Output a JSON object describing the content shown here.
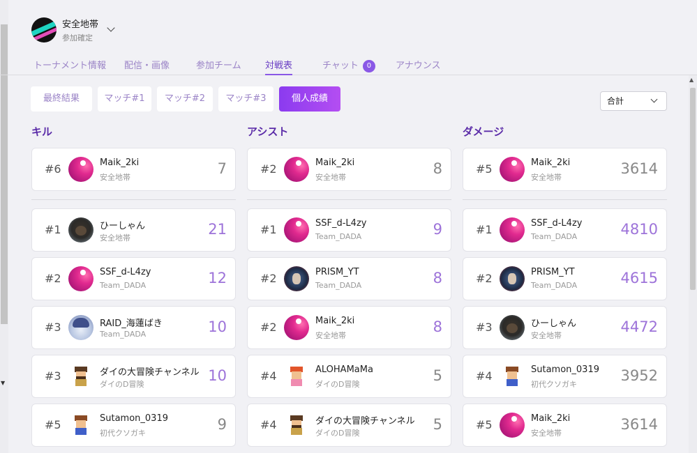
{
  "team": {
    "name": "安全地帯",
    "status": "参加確定"
  },
  "tabs": [
    {
      "label": "トーナメント情報"
    },
    {
      "label": "配信・画像"
    },
    {
      "label": "参加チーム"
    },
    {
      "label": "対戦表",
      "active": true
    },
    {
      "label": "チャット",
      "badge": "0"
    },
    {
      "label": "アナウンス"
    }
  ],
  "segments": [
    {
      "label": "最終結果"
    },
    {
      "label": "マッチ#1"
    },
    {
      "label": "マッチ#2"
    },
    {
      "label": "マッチ#3"
    },
    {
      "label": "個人成績",
      "active": true
    }
  ],
  "select": {
    "value": "合計"
  },
  "columns": [
    {
      "title": "キル",
      "own": {
        "rank": "#6",
        "name": "Maik_2ki",
        "team": "安全地帯",
        "value": "7",
        "avatar": "pink-avatar"
      },
      "rows": [
        {
          "rank": "#1",
          "name": "ひーしゃん",
          "team": "安全地帯",
          "value": "21",
          "avatar": "dark-avatar"
        },
        {
          "rank": "#2",
          "name": "SSF_d-L4zy",
          "team": "Team_DADA",
          "value": "12",
          "avatar": "pink-avatar"
        },
        {
          "rank": "#3",
          "name": "RAID_海蓮ばき",
          "team": "Team_DADA",
          "value": "10",
          "avatar": "anime-avatar"
        },
        {
          "rank": "#3",
          "name": "ダイの大冒険チャンネル",
          "team": "ダイのD冒険",
          "value": "10",
          "avatar": "pixel-beard-avatar"
        },
        {
          "rank": "#5",
          "name": "Sutamon_0319",
          "team": "初代クソガキ",
          "value": "9",
          "avatar": "pixel-boy-avatar"
        }
      ]
    },
    {
      "title": "アシスト",
      "own": {
        "rank": "#2",
        "name": "Maik_2ki",
        "team": "安全地帯",
        "value": "8",
        "avatar": "pink-avatar"
      },
      "rows": [
        {
          "rank": "#1",
          "name": "SSF_d-L4zy",
          "team": "Team_DADA",
          "value": "9",
          "avatar": "pink-avatar"
        },
        {
          "rank": "#2",
          "name": "PRISM_YT",
          "team": "Team_DADA",
          "value": "8",
          "avatar": "prism-avatar"
        },
        {
          "rank": "#2",
          "name": "Maik_2ki",
          "team": "安全地帯",
          "value": "8",
          "avatar": "pink-avatar"
        },
        {
          "rank": "#4",
          "name": "ALOHAMaMa",
          "team": "ダイのD冒険",
          "value": "5",
          "avatar": "pixel-girl-avatar"
        },
        {
          "rank": "#4",
          "name": "ダイの大冒険チャンネル",
          "team": "ダイのD冒険",
          "value": "5",
          "avatar": "pixel-beard-avatar"
        }
      ]
    },
    {
      "title": "ダメージ",
      "own": {
        "rank": "#5",
        "name": "Maik_2ki",
        "team": "安全地帯",
        "value": "3614",
        "avatar": "pink-avatar"
      },
      "rows": [
        {
          "rank": "#1",
          "name": "SSF_d-L4zy",
          "team": "Team_DADA",
          "value": "4810",
          "avatar": "pink-avatar"
        },
        {
          "rank": "#2",
          "name": "PRISM_YT",
          "team": "Team_DADA",
          "value": "4615",
          "avatar": "prism-avatar"
        },
        {
          "rank": "#3",
          "name": "ひーしゃん",
          "team": "安全地帯",
          "value": "4472",
          "avatar": "dark-avatar"
        },
        {
          "rank": "#4",
          "name": "Sutamon_0319",
          "team": "初代クソガキ",
          "value": "3952",
          "avatar": "pixel-boy-avatar"
        },
        {
          "rank": "#5",
          "name": "Maik_2ki",
          "team": "安全地帯",
          "value": "3614",
          "avatar": "pink-avatar"
        }
      ]
    }
  ],
  "colors": {
    "accent": "#8a58e6",
    "highlight_value": "#9d73d9",
    "muted_value": "#888888"
  }
}
